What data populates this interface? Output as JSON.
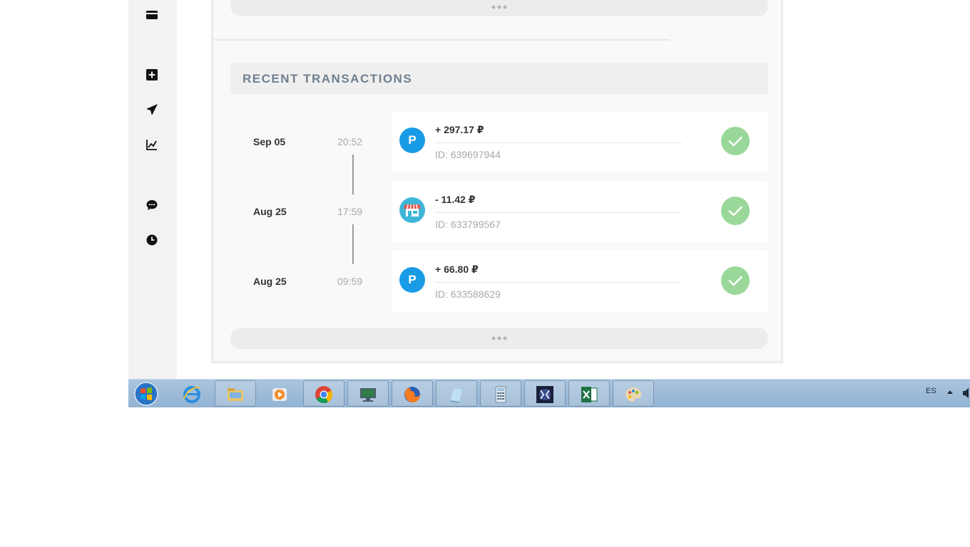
{
  "section": {
    "title": "RECENT TRANSACTIONS"
  },
  "transactions": [
    {
      "date": "Sep 05",
      "time": "20:52",
      "avatar_letter": "P",
      "avatar_type": "p-icon",
      "amount": "+ 297.17 ₽",
      "id": "ID: 639697944",
      "status": "check-icon"
    },
    {
      "date": "Aug 25",
      "time": "17:59",
      "avatar_letter": "",
      "avatar_type": "shop-icon",
      "amount": "- 11.42 ₽",
      "id": "ID: 633799567",
      "status": "check-icon"
    },
    {
      "date": "Aug 25",
      "time": "09:59",
      "avatar_letter": "P",
      "avatar_type": "p-icon",
      "amount": "+ 66.80 ₽",
      "id": "ID: 633588629",
      "status": "check-icon"
    }
  ],
  "sidebar": {
    "icons": [
      "card-icon",
      "add-icon",
      "send-icon",
      "chart-icon",
      "chat-icon",
      "clock-icon"
    ]
  },
  "taskbar": {
    "lang": "ES",
    "apps": [
      "internet-explorer-icon",
      "file-explorer-icon",
      "media-player-icon",
      "chrome-icon",
      "remote-desktop-icon",
      "firefox-icon",
      "notepad-icon",
      "calculator-icon",
      "game-icon",
      "excel-icon",
      "paint-icon"
    ]
  },
  "colors": {
    "accent": "#1a9be6",
    "success": "#9ad89a",
    "title": "#6f7f8e"
  }
}
